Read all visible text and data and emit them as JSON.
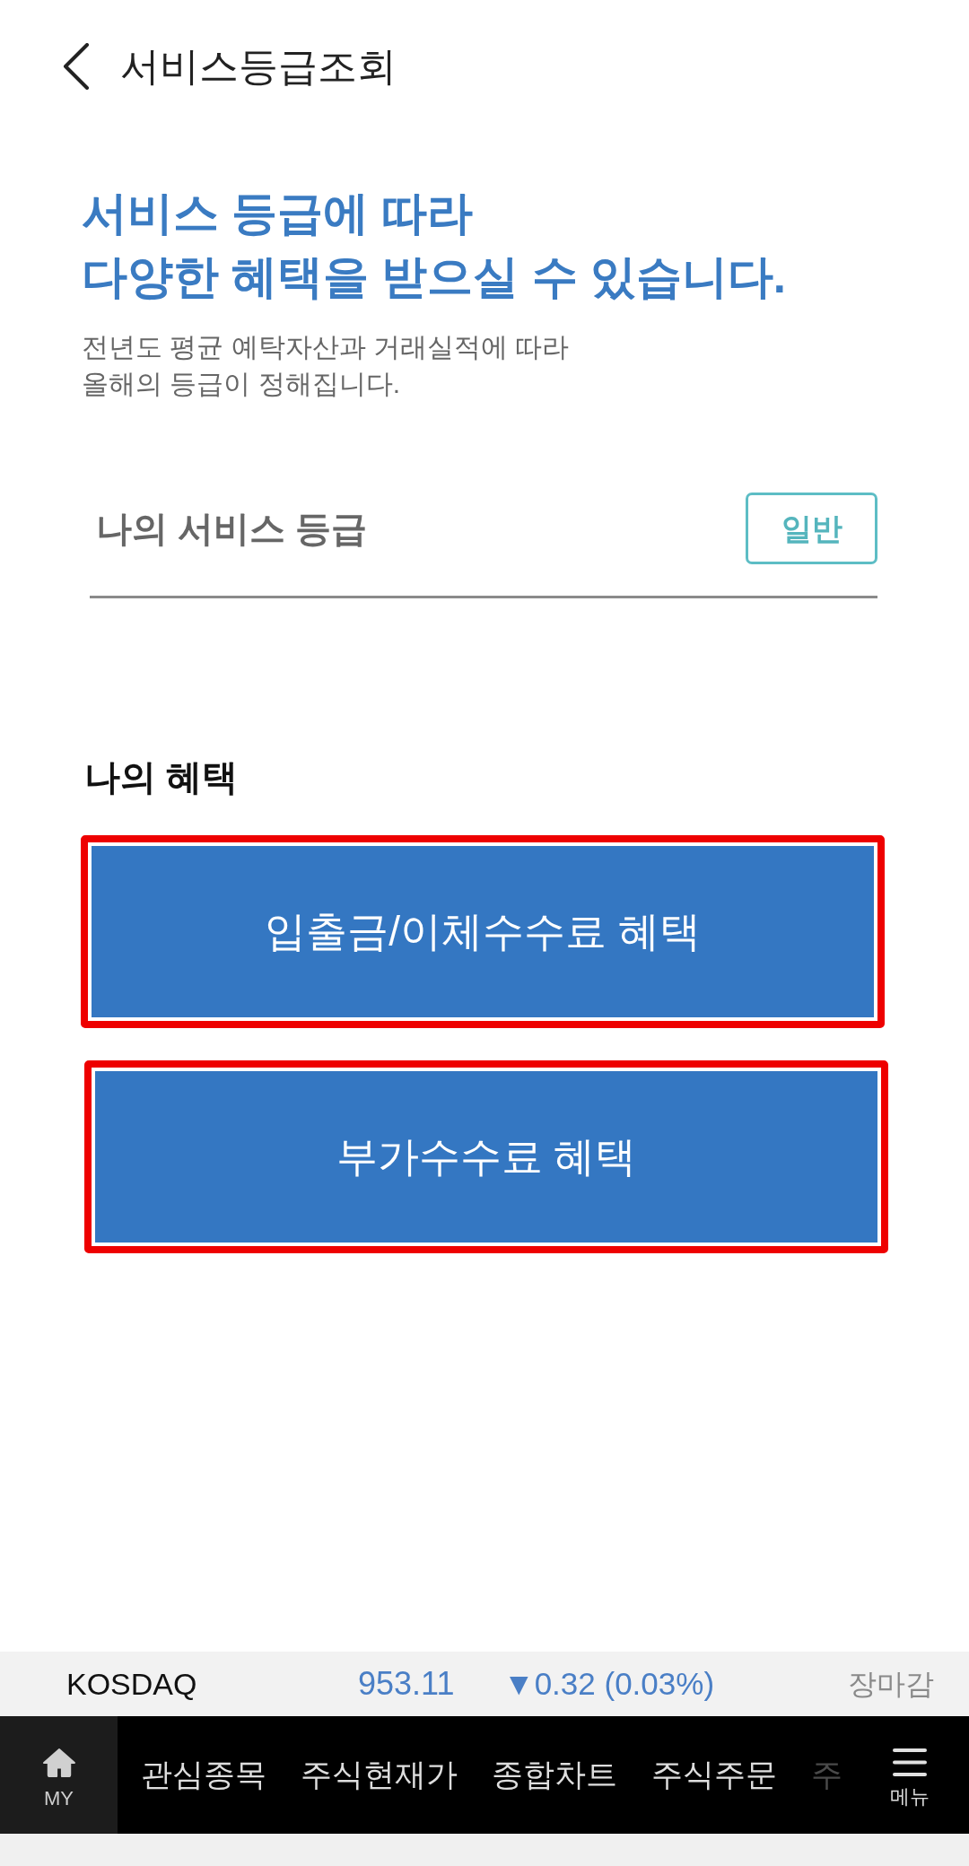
{
  "header": {
    "title": "서비스등급조회"
  },
  "intro": {
    "headline": [
      "서비스 등급에 따라",
      "다양한 혜택을 받으실 수 있습니다."
    ],
    "description": [
      "전년도 평균 예탁자산과 거래실적에 따라",
      "올해의 등급이 정해집니다."
    ]
  },
  "grade": {
    "label": "나의 서비스 등급",
    "value": "일반"
  },
  "benefits": {
    "title": "나의 혜택",
    "items": [
      {
        "label": "입출금/이체수수료 혜택",
        "highlighted": true
      },
      {
        "label": "부가수수료 혜택",
        "highlighted": true
      }
    ]
  },
  "ticker": {
    "index": "KOSDAQ",
    "value": "953.11",
    "change": "▼0.32 (0.03%)",
    "falling": true,
    "status": "장마감"
  },
  "bottom_nav": {
    "home": {
      "label": "MY"
    },
    "items": [
      {
        "label": "관심종목",
        "faded": false
      },
      {
        "label": "주식현재가",
        "faded": false
      },
      {
        "label": "종합차트",
        "faded": false
      },
      {
        "label": "주식주문",
        "faded": false
      },
      {
        "label": "주",
        "faded": true
      }
    ],
    "menu": {
      "label": "메뉴"
    }
  }
}
